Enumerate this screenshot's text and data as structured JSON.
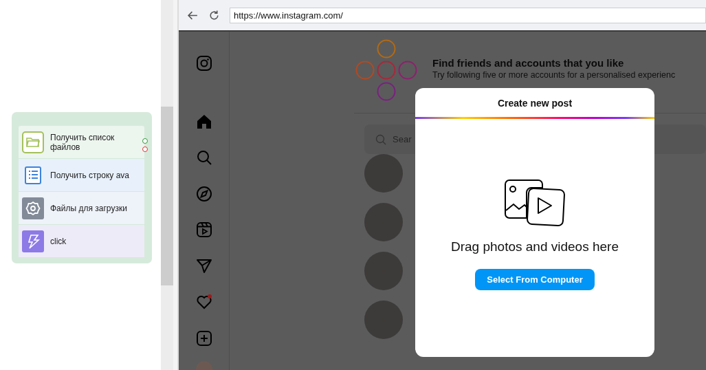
{
  "node_card": {
    "rows": [
      {
        "kind": "folder",
        "label": "Получить список файлов",
        "color": "#edf5ef"
      },
      {
        "kind": "list",
        "label": "Получить строку ava",
        "color": "#e8f1fb"
      },
      {
        "kind": "gear",
        "label": "Файлы для загрузки",
        "color": "#eef2f9"
      },
      {
        "kind": "bolt",
        "label": "click",
        "color": "#eeebf8"
      }
    ]
  },
  "browser": {
    "url": "https://www.instagram.com/"
  },
  "suggestions": {
    "title": "Find friends and accounts that you like",
    "subtitle": "Try following five or more accounts for a personalised experienc",
    "search_placeholder": "Sear"
  },
  "modal": {
    "title": "Create new post",
    "message": "Drag photos and videos here",
    "button": "Select From Computer"
  }
}
